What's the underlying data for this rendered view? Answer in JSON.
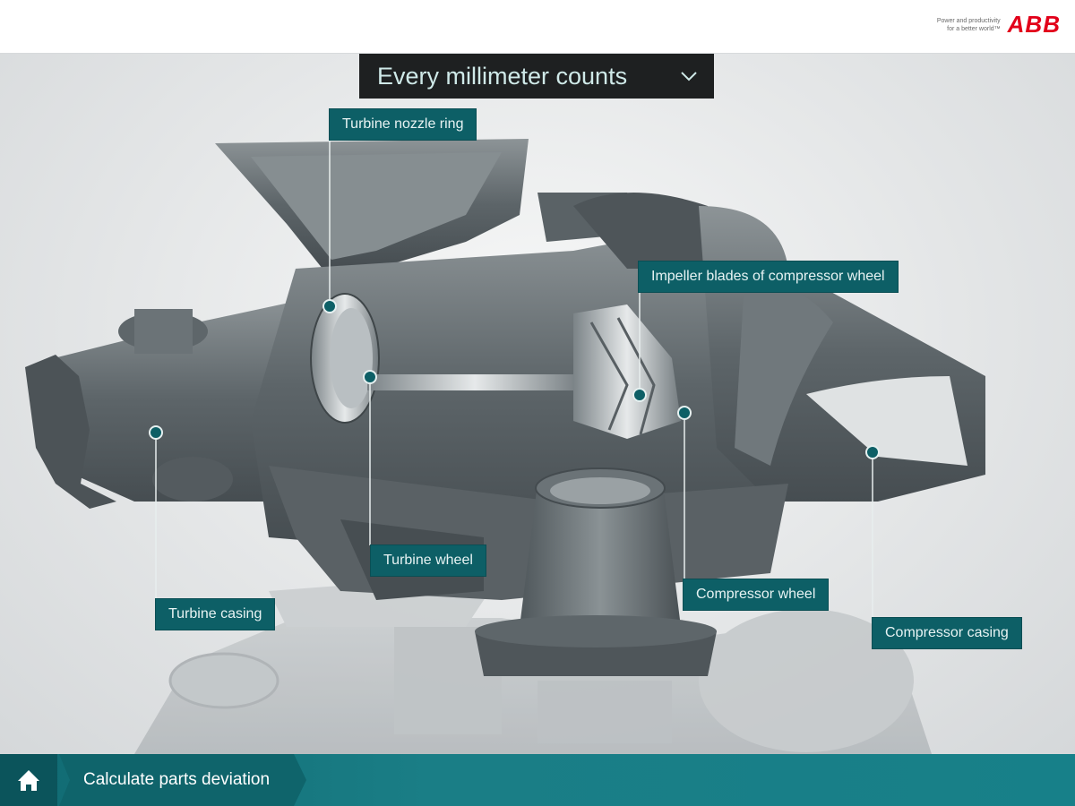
{
  "header": {
    "tagline_line1": "Power and productivity",
    "tagline_line2": "for a better world™",
    "logo_text": "ABB"
  },
  "view_selector": {
    "selected": "Every millimeter counts",
    "icon": "chevron-down-icon"
  },
  "callouts": [
    {
      "label": "Turbine nozzle ring"
    },
    {
      "label": "Impeller blades of compressor wheel"
    },
    {
      "label": "Turbine wheel"
    },
    {
      "label": "Turbine casing"
    },
    {
      "label": "Compressor wheel"
    },
    {
      "label": "Compressor casing"
    }
  ],
  "footer": {
    "home_icon": "home-icon",
    "action_label": "Calculate parts deviation"
  },
  "colors": {
    "callout_bg": "#0d5f66",
    "footer_bg": "#178089",
    "dropdown_bg": "#1e2021",
    "logo": "#e2001a",
    "marker": "#0d5f66"
  }
}
